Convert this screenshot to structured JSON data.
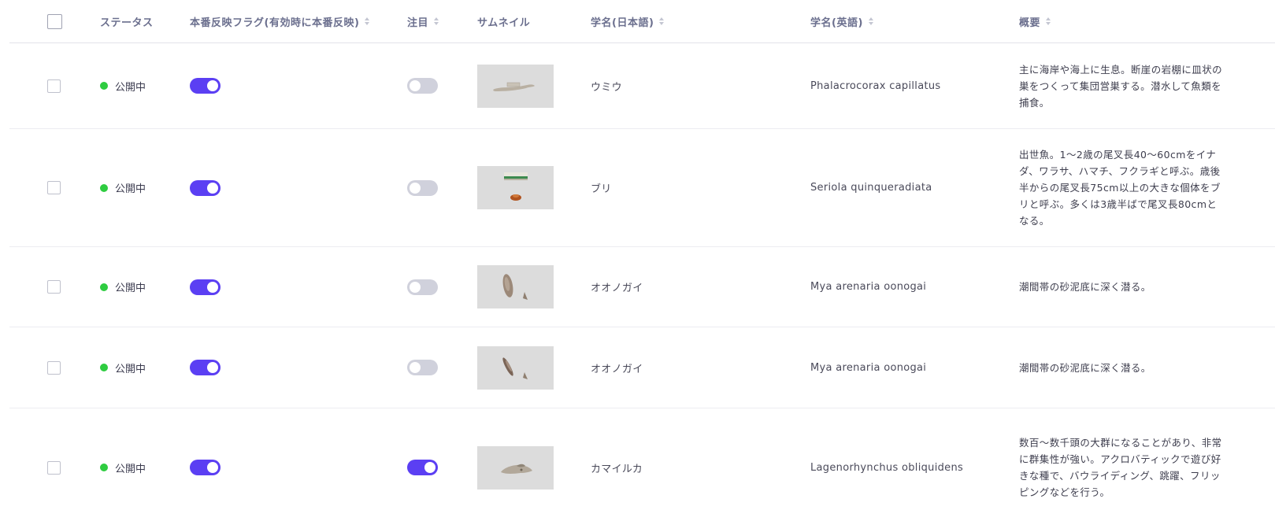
{
  "colors": {
    "accent": "#5b3ff3",
    "toggle_off": "#d0d1dc",
    "status_published": "#2ecc40"
  },
  "header": {
    "status": "ステータス",
    "flag": "本番反映フラグ(有効時に本番反映)",
    "attention": "注目",
    "thumbnail": "サムネイル",
    "name_ja": "学名(日本語)",
    "name_en": "学名(英語)",
    "summary": "概要"
  },
  "rows": [
    {
      "status": "公開中",
      "production_flag": true,
      "attention": false,
      "thumbnail_icon": "bone-thumbnail",
      "name_ja": "ウミウ",
      "name_en": "Phalacrocorax capillatus",
      "summary": "主に海岸や海上に生息。断崖の岩棚に皿状の巣をつくって集団営巣する。潜水して魚類を捕食。"
    },
    {
      "status": "公開中",
      "production_flag": true,
      "attention": false,
      "thumbnail_icon": "fish-specimen-thumbnail",
      "name_ja": "ブリ",
      "name_en": "Seriola quinqueradiata",
      "summary": "出世魚。1〜2歳の尾叉長40〜60cmをイナダ、ワラサ、ハマチ、フクラギと呼ぶ。歳後半からの尾叉長75cm以上の大きな個体をブリと呼ぶ。多くは3歳半ばで尾叉長80cmとなる。"
    },
    {
      "status": "公開中",
      "production_flag": true,
      "attention": false,
      "thumbnail_icon": "shell-thumbnail",
      "name_ja": "オオノガイ",
      "name_en": "Mya arenaria oonogai",
      "summary": "潮間帯の砂泥底に深く潜る。"
    },
    {
      "status": "公開中",
      "production_flag": true,
      "attention": false,
      "thumbnail_icon": "shell-thumbnail",
      "name_ja": "オオノガイ",
      "name_en": "Mya arenaria oonogai",
      "summary": "潮間帯の砂泥底に深く潜る。"
    },
    {
      "status": "公開中",
      "production_flag": true,
      "attention": true,
      "thumbnail_icon": "skull-thumbnail",
      "name_ja": "カマイルカ",
      "name_en": "Lagenorhynchus obliquidens",
      "summary": "数百〜数千頭の大群になることがあり、非常に群集性が強い。アクロバティックで遊び好きな種で、バウライディング、跳躍、フリッピングなどを行う。"
    }
  ]
}
